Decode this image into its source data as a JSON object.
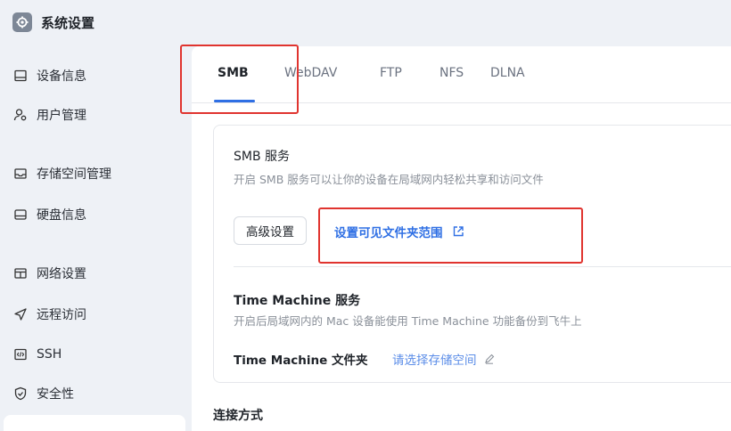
{
  "app": {
    "title": "系统设置",
    "icon": "gear-icon"
  },
  "sidebar": {
    "items": [
      {
        "label": "设备信息",
        "icon": "device-icon"
      },
      {
        "label": "用户管理",
        "icon": "user-icon"
      },
      {
        "label": "存储空间管理",
        "icon": "storage-icon"
      },
      {
        "label": "硬盘信息",
        "icon": "disk-icon"
      },
      {
        "label": "网络设置",
        "icon": "network-icon"
      },
      {
        "label": "远程访问",
        "icon": "remote-access-icon"
      },
      {
        "label": "SSH",
        "icon": "ssh-icon"
      },
      {
        "label": "安全性",
        "icon": "security-shield-icon"
      }
    ]
  },
  "tabs": [
    "SMB",
    "WebDAV",
    "FTP",
    "NFS",
    "DLNA"
  ],
  "active_tab": "SMB",
  "smb": {
    "title": "SMB 服务",
    "description": "开启 SMB 服务可以让你的设备在局域网内轻松共享和访问文件",
    "advanced_button": "高级设置",
    "visible_folders_link": "设置可见文件夹范围"
  },
  "time_machine": {
    "title": "Time Machine 服务",
    "description": "开启后局域网内的 Mac 设备能使用 Time Machine 功能备份到飞牛上",
    "folder_label": "Time Machine 文件夹",
    "folder_placeholder": "请选择存储空间"
  },
  "connection": {
    "title": "连接方式"
  },
  "colors": {
    "accent": "#2f6fe4",
    "highlight": "#e0342f",
    "background": "#eef1f6"
  }
}
